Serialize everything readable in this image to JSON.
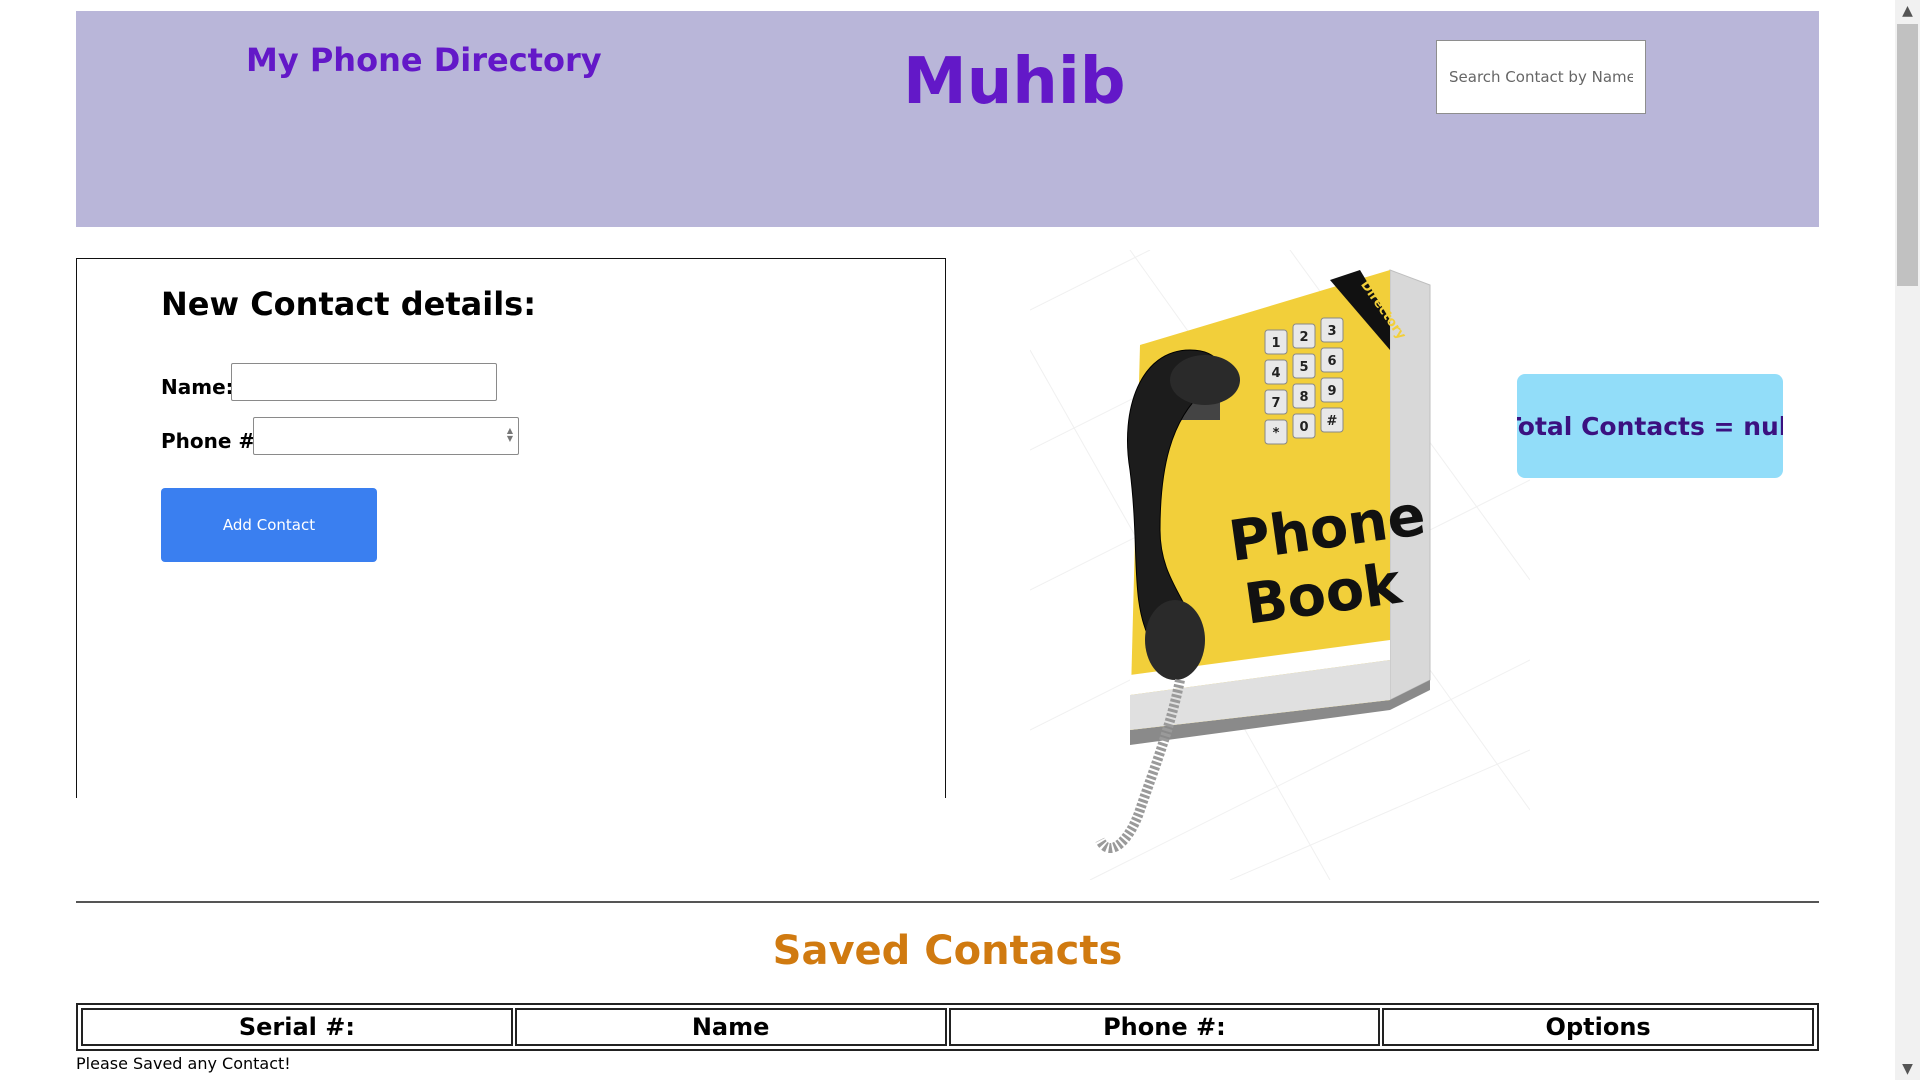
{
  "header": {
    "brand": "My Phone Directory",
    "owner": "Muhib",
    "search_placeholder": "Search Contact by Name"
  },
  "form": {
    "title": "New Contact details:",
    "name_label": "Name:",
    "phone_label": "Phone #:",
    "name_value": "",
    "phone_value": "",
    "add_button": "Add Contact"
  },
  "illustration": {
    "line1": "Phone",
    "line2": "Book",
    "tab": "Directory",
    "keys": [
      "1",
      "2",
      "3",
      "4",
      "5",
      "6",
      "7",
      "8",
      "9",
      "*",
      "0",
      "#"
    ]
  },
  "stats": {
    "total": "Total Contacts = null"
  },
  "saved": {
    "title": "Saved Contacts",
    "columns": [
      "Serial #:",
      "Name",
      "Phone #:",
      "Options"
    ],
    "empty_message": "Please Saved any Contact!"
  },
  "colors": {
    "header_bg": "#b9b6d9",
    "brand": "#6318c8",
    "button": "#3a7ff0",
    "total_bg": "#92ddf9",
    "saved_title": "#d07a10"
  }
}
